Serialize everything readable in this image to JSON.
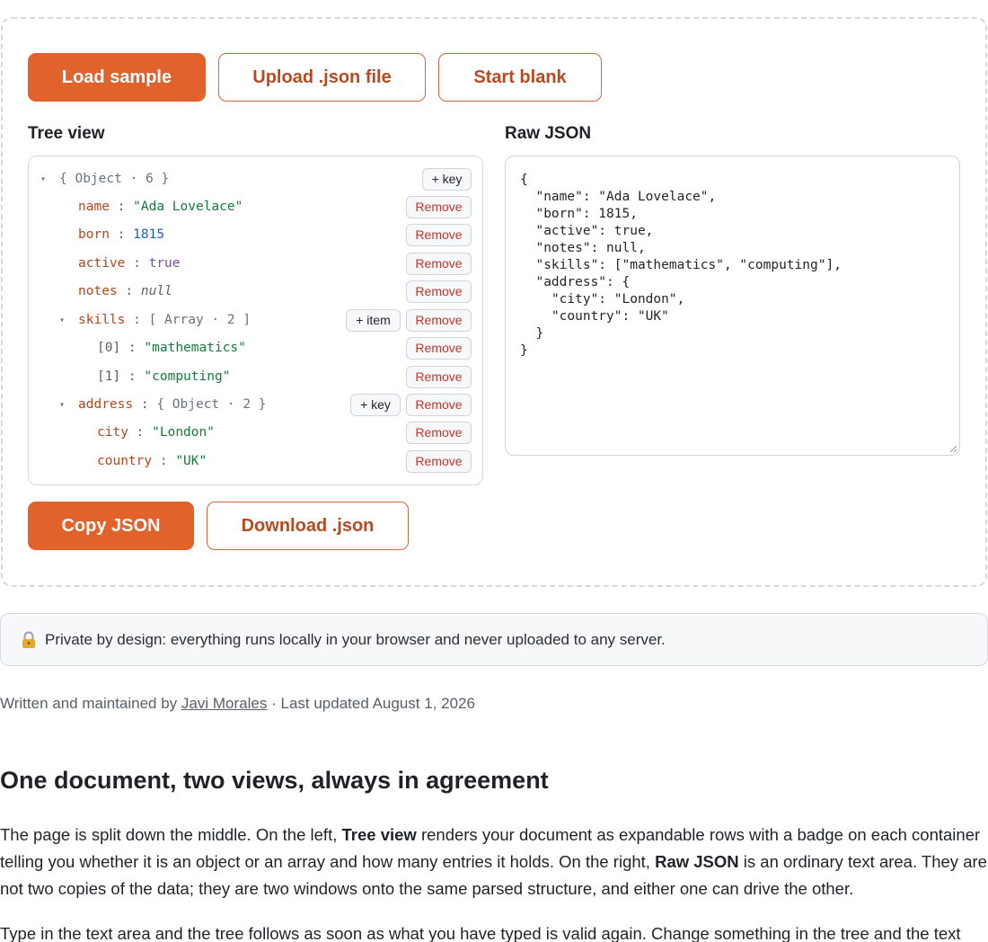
{
  "toolbar": {
    "load_sample": "Load sample",
    "upload_json": "Upload .json file",
    "start_blank": "Start blank"
  },
  "tree_view": {
    "title": "Tree view",
    "root_badge": "{ Object · 6 }",
    "add_key_label": "+ key",
    "add_item_label": "+ item",
    "remove_label": "Remove",
    "rows": [
      {
        "key": "name",
        "value": "\"Ada Lovelace\"",
        "type": "string"
      },
      {
        "key": "born",
        "value": "1815",
        "type": "number"
      },
      {
        "key": "active",
        "value": "true",
        "type": "boolean"
      },
      {
        "key": "notes",
        "value": "null",
        "type": "null"
      },
      {
        "key": "skills",
        "badge": "[ Array · 2 ]",
        "type": "array"
      },
      {
        "key": "[0]",
        "value": "\"mathematics\"",
        "type": "string"
      },
      {
        "key": "[1]",
        "value": "\"computing\"",
        "type": "string"
      },
      {
        "key": "address",
        "badge": "{ Object · 2 }",
        "type": "object"
      },
      {
        "key": "city",
        "value": "\"London\"",
        "type": "string"
      },
      {
        "key": "country",
        "value": "\"UK\"",
        "type": "string"
      }
    ]
  },
  "raw_json": {
    "title": "Raw JSON",
    "text": "{\n  \"name\": \"Ada Lovelace\",\n  \"born\": 1815,\n  \"active\": true,\n  \"notes\": null,\n  \"skills\": [\"mathematics\", \"computing\"],\n  \"address\": {\n    \"city\": \"London\",\n    \"country\": \"UK\"\n  }\n}"
  },
  "actions": {
    "copy_json": "Copy JSON",
    "download_json": "Download .json"
  },
  "privacy_note": {
    "icon": "lock-icon",
    "text": "Private by design: everything runs locally in your browser and never uploaded to any server."
  },
  "byline": {
    "prefix": "Written and maintained by",
    "author": "Javi Morales",
    "separator": "·",
    "updated": "Last updated August 1, 2026"
  },
  "article": {
    "heading": "One document, two views, always in agreement",
    "p1_a": "The page is split down the middle. On the left, ",
    "p1_b1": "Tree view",
    "p1_c": " renders your document as expandable rows with a badge on each container telling you whether it is an object or an array and how many entries it holds. On the right, ",
    "p1_b2": "Raw JSON",
    "p1_d": " is an ordinary text area. They are not two copies of the data; they are two windows onto the same parsed structure, and either one can drive the other.",
    "p2": "Type in the text area and the tree follows as soon as what you have typed is valid again. Change something in the tree and the text"
  },
  "colors": {
    "accent": "#e2622c",
    "key": "#b5461d",
    "string": "#167a3c",
    "number": "#1e5fb3",
    "boolean": "#8a3fbf",
    "remove": "#c0362c"
  }
}
